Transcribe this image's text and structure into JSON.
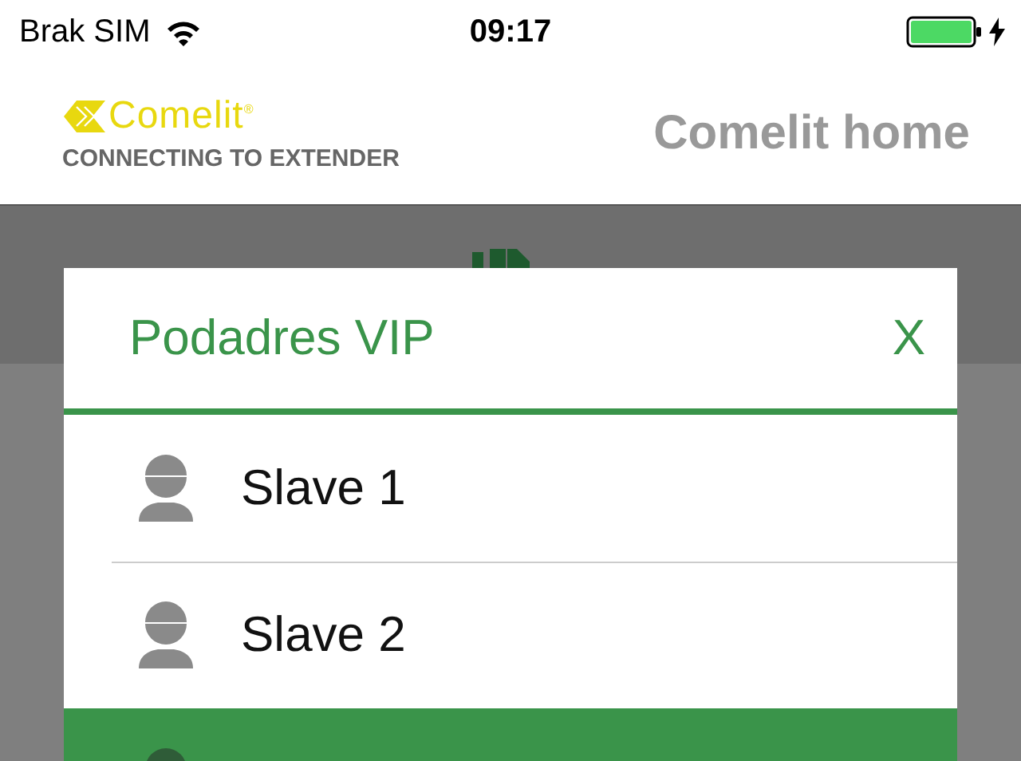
{
  "status_bar": {
    "carrier": "Brak SIM",
    "time": "09:17"
  },
  "header": {
    "logo": "Comelit$^{®}$",
    "subtitle": "CONNECTING TO EXTENDER",
    "title": "Comelit home"
  },
  "dialog": {
    "title": "Podadres VIP",
    "close": "X",
    "items": [
      {
        "label": "Slave 1",
        "selected": false
      },
      {
        "label": "Slave 2",
        "selected": false
      },
      {
        "selected": true
      }
    ]
  }
}
